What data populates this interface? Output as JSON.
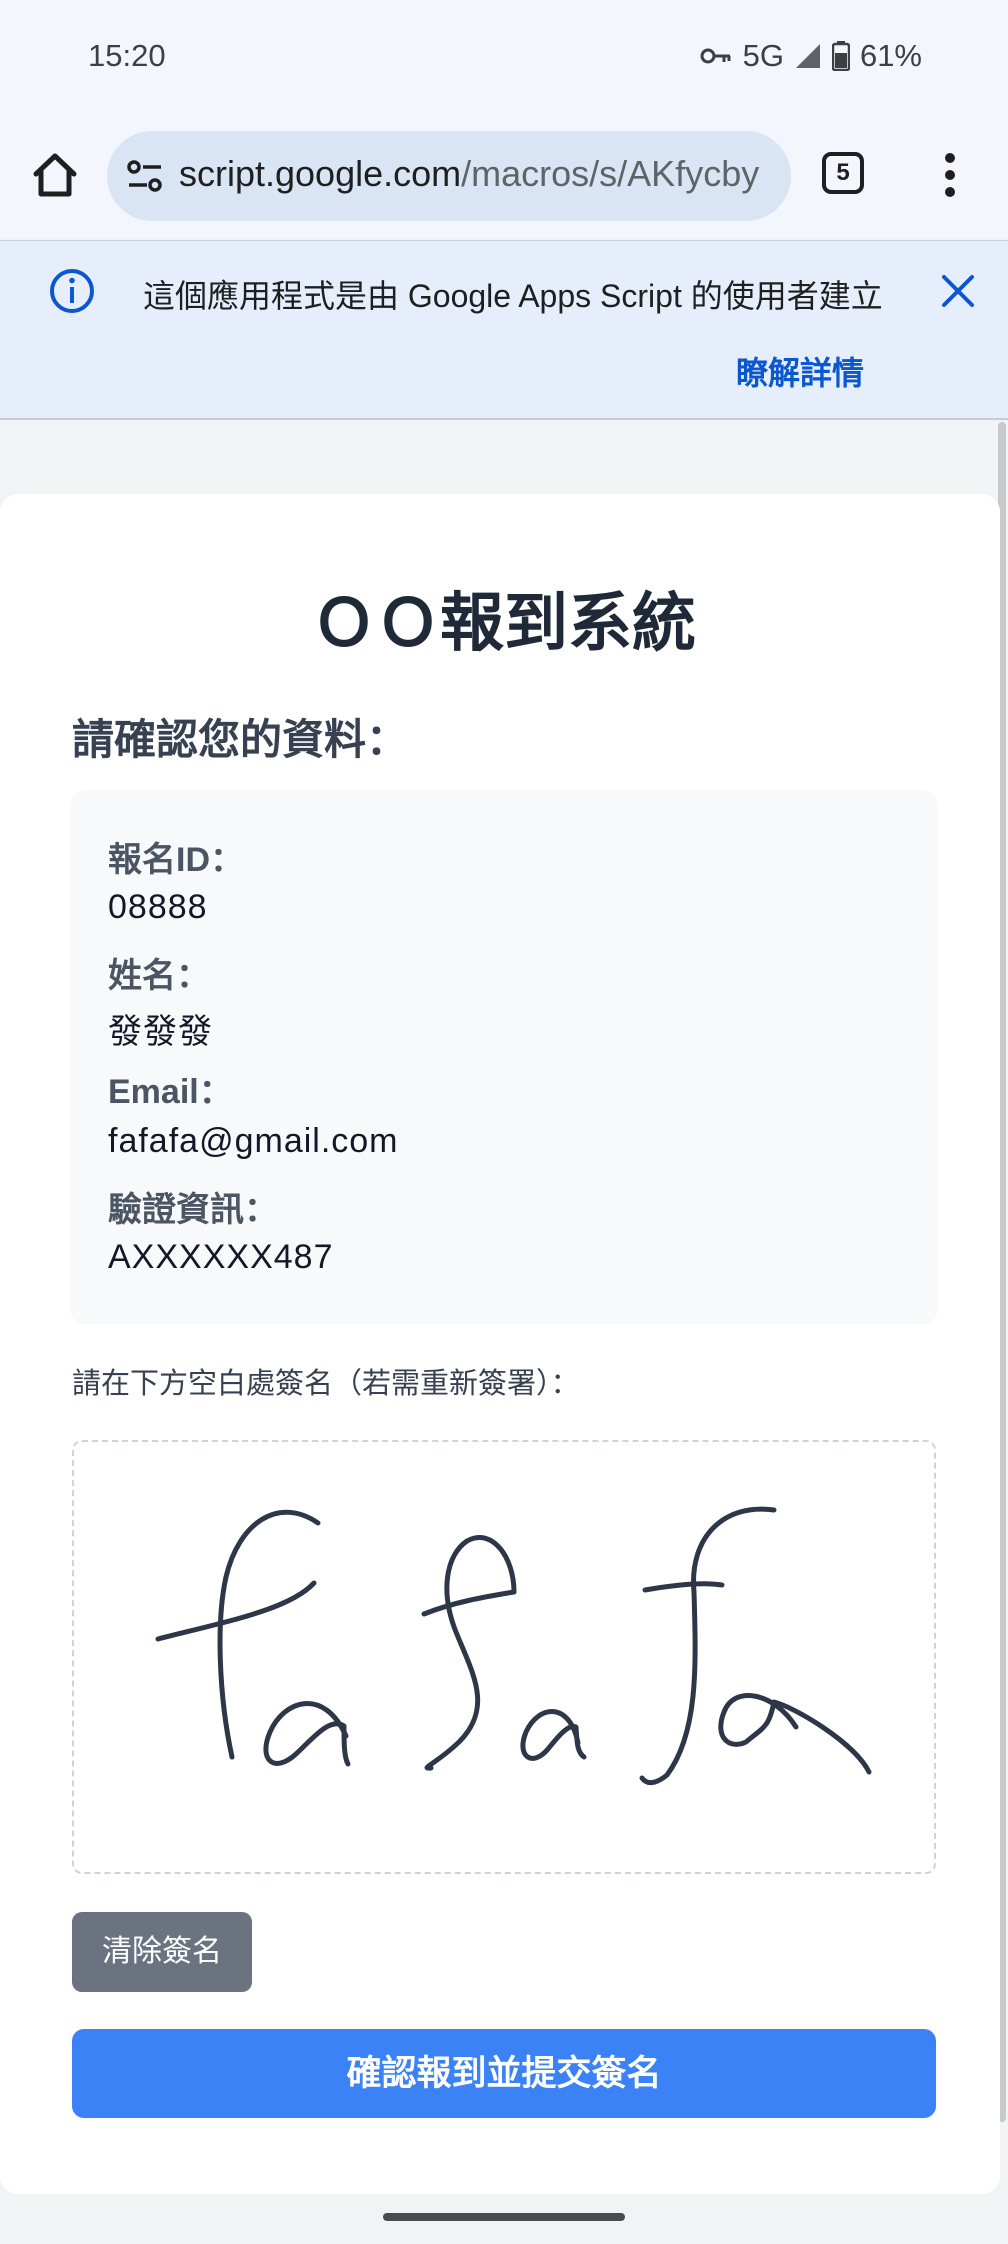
{
  "status": {
    "time": "15:20",
    "network": "5G",
    "battery": "61%"
  },
  "browser": {
    "url_host": "script.google.com",
    "url_path": "/macros/s/AKfycby",
    "tab_count": "5"
  },
  "banner": {
    "message": "這個應用程式是由 Google Apps Script 的使用者建立",
    "learn_more": "瞭解詳情"
  },
  "page": {
    "title": "ＯＯ報到系統",
    "subtitle": "請確認您的資料：",
    "fields": [
      {
        "label": "報名ID：",
        "value": "08888"
      },
      {
        "label": "姓名：",
        "value": "發發發"
      },
      {
        "label": "Email：",
        "value": "fafafa@gmail.com"
      },
      {
        "label": "驗證資訊：",
        "value": "AXXXXXX487"
      }
    ],
    "signature_hint": "請在下方空白處簽名（若需重新簽署）：",
    "signature_text": "fafafa",
    "clear_button": "清除簽名",
    "submit_button": "確認報到並提交簽名"
  },
  "colors": {
    "primary": "#3b82f6",
    "secondary_button": "#6b7280",
    "link": "#0b57d0"
  },
  "icons": [
    "key-icon",
    "signal-icon",
    "battery-icon",
    "home-icon",
    "tune-icon",
    "tab-switcher-icon",
    "more-vert-icon",
    "info-icon",
    "close-icon"
  ]
}
